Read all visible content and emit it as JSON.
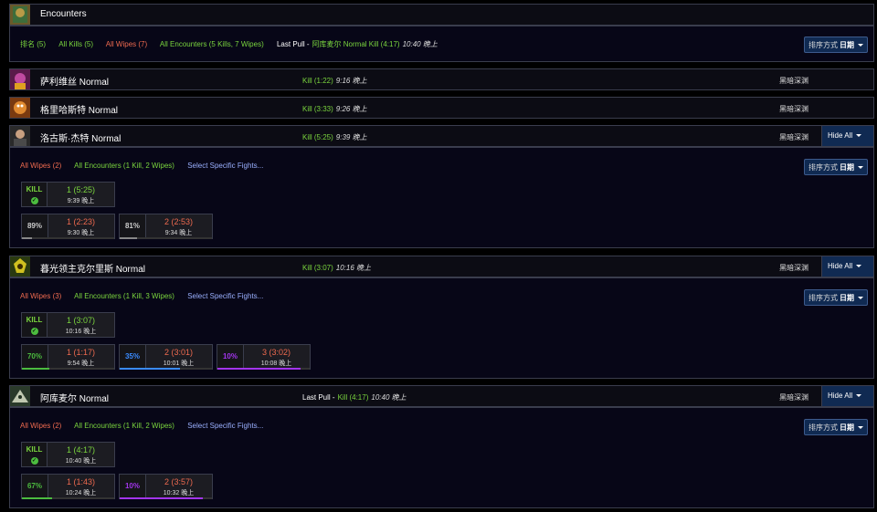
{
  "encounters": {
    "title": "Encounters",
    "filters": {
      "rank": "排名 (5)",
      "all_kills": "All Kills (5)",
      "all_wipes": "All Wipes (7)",
      "all_encounters": "All Encounters (5 Kills, 7 Wipes)",
      "last_pull_label": "Last Pull -",
      "last_pull_value": "阿库麦尔 Normal Kill (4:17)",
      "last_pull_time": "10:40 晚上"
    },
    "sort_label": "排序方式",
    "sort_value": "日期"
  },
  "bosses": [
    {
      "name": "萨利维丝 Normal",
      "kill": "Kill (1:22)",
      "time": "9:16 晚上",
      "zone": "黑暗深渊"
    },
    {
      "name": "格里哈斯特 Normal",
      "kill": "Kill (3:33)",
      "time": "9:26 晚上",
      "zone": "黑暗深渊"
    },
    {
      "name": "洛古斯·杰特 Normal",
      "kill": "Kill (5:25)",
      "time": "9:39 晚上",
      "zone": "黑暗深渊",
      "hide_label": "Hide All",
      "filters": {
        "wipes": "All Wipes (2)",
        "encounters": "All Encounters (1 Kill, 2 Wipes)",
        "select": "Select Specific Fights..."
      },
      "sort_label": "排序方式",
      "sort_value": "日期",
      "kill_fight": {
        "label": "KILL",
        "num": "1 (5:25)",
        "time": "9:39 晚上"
      },
      "wipes": [
        {
          "pct": "89%",
          "progress": 0.11,
          "num": "1 (2:23)",
          "time": "9:30 晚上"
        },
        {
          "pct": "81%",
          "progress": 0.19,
          "num": "2 (2:53)",
          "time": "9:34 晚上"
        }
      ]
    },
    {
      "name": "暮光领主克尔里斯 Normal",
      "kill": "Kill (3:07)",
      "time": "10:16 晚上",
      "zone": "黑暗深渊",
      "hide_label": "Hide All",
      "filters": {
        "wipes": "All Wipes (3)",
        "encounters": "All Encounters (1 Kill, 3 Wipes)",
        "select": "Select Specific Fights..."
      },
      "sort_label": "排序方式",
      "sort_value": "日期",
      "kill_fight": {
        "label": "KILL",
        "num": "1 (3:07)",
        "time": "10:16 晚上"
      },
      "wipes": [
        {
          "pct": "70%",
          "progress": 0.3,
          "num": "1 (1:17)",
          "time": "9:54 晚上"
        },
        {
          "pct": "35%",
          "progress": 0.65,
          "num": "2 (3:01)",
          "time": "10:01 晚上"
        },
        {
          "pct": "10%",
          "progress": 0.9,
          "num": "3 (3:02)",
          "time": "10:08 晚上"
        }
      ]
    },
    {
      "name": "阿库麦尔 Normal",
      "last_pull_label": "Last Pull -",
      "kill": "Kill (4:17)",
      "time": "10:40 晚上",
      "zone": "黑暗深渊",
      "hide_label": "Hide All",
      "filters": {
        "wipes": "All Wipes (2)",
        "encounters": "All Encounters (1 Kill, 2 Wipes)",
        "select": "Select Specific Fights..."
      },
      "sort_label": "排序方式",
      "sort_value": "日期",
      "kill_fight": {
        "label": "KILL",
        "num": "1 (4:17)",
        "time": "10:40 晚上"
      },
      "wipes": [
        {
          "pct": "67%",
          "progress": 0.33,
          "num": "1 (1:43)",
          "time": "10:24 晚上"
        },
        {
          "pct": "10%",
          "progress": 0.9,
          "num": "2 (3:57)",
          "time": "10:32 晚上"
        }
      ]
    }
  ],
  "colors": {
    "kill": "#7ad53e",
    "wipe": "#ee6a4f",
    "link": "#9ab0ff",
    "pct_green": "#4cbc3f",
    "pct_blue": "#3a8bff",
    "pct_purple": "#a335ee"
  }
}
